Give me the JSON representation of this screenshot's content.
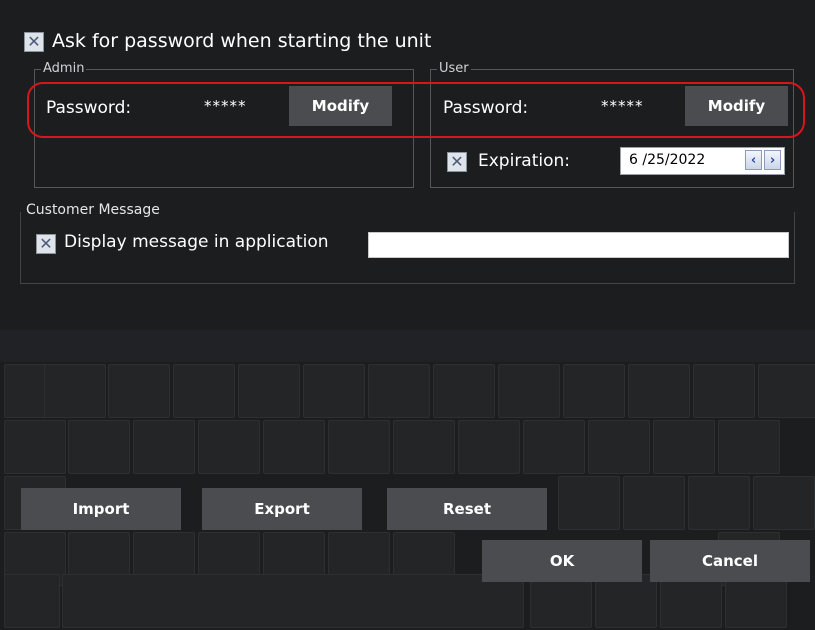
{
  "ask_password": {
    "label": "Ask for password when starting the unit",
    "checked": true
  },
  "admin": {
    "legend": "Admin",
    "password_label": "Password:",
    "password_value": "*****",
    "modify_label": "Modify"
  },
  "user": {
    "legend": "User",
    "password_label": "Password:",
    "password_value": "*****",
    "modify_label": "Modify",
    "expiration_label": "Expiration:",
    "expiration_checked": true,
    "expiration_date": "6 /25/2022"
  },
  "customer_message": {
    "legend": "Customer Message",
    "display_label": "Display message in application",
    "display_checked": true,
    "message_value": ""
  },
  "buttons": {
    "import": "Import",
    "export": "Export",
    "reset": "Reset",
    "ok": "OK",
    "cancel": "Cancel"
  },
  "icons": {
    "checkbox": "x-check-icon",
    "spin_left": "chevron-left-icon",
    "spin_right": "chevron-right-icon"
  },
  "colors": {
    "background": "#1c1d1f",
    "button": "#4a4c4f",
    "highlight": "#d8161a"
  }
}
